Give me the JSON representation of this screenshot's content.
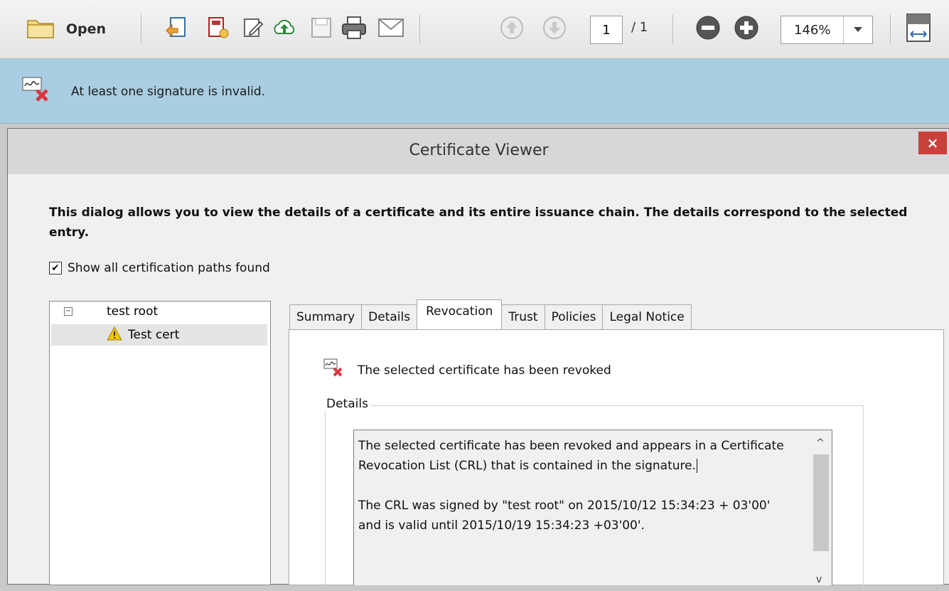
{
  "toolbar": {
    "open_label": "Open",
    "page_current": "1",
    "page_total": "/ 1",
    "zoom_value": "146%",
    "icons": [
      "folder-icon",
      "export-icon",
      "create-pdf-icon",
      "edit-icon",
      "upload-icon",
      "save-icon",
      "print-icon",
      "email-icon",
      "page-up-icon",
      "page-down-icon",
      "zoom-out-icon",
      "zoom-in-icon",
      "fit-width-icon"
    ]
  },
  "infobar": {
    "message": "At least one signature is invalid."
  },
  "dialog": {
    "title": "Certificate Viewer",
    "close_label": "×",
    "intro": "This dialog allows you to view the details of a certificate and its entire issuance chain. The details correspond to the selected entry.",
    "show_all_paths_label": "Show all certification paths found",
    "show_all_paths_checked": true,
    "tree": {
      "expander": "−",
      "root": "test root",
      "child": "Test cert"
    },
    "tabs": [
      {
        "label": "Summary",
        "active": false
      },
      {
        "label": "Details",
        "active": false
      },
      {
        "label": "Revocation",
        "active": true
      },
      {
        "label": "Trust",
        "active": false
      },
      {
        "label": "Policies",
        "active": false
      },
      {
        "label": "Legal Notice",
        "active": false
      }
    ],
    "revocation": {
      "status": "The selected certificate has been revoked",
      "group_label": "Details",
      "details_p1": "The selected certificate has been revoked and appears in a Certificate Revocation List (CRL) that is contained in the signature.",
      "details_p2": "The CRL was signed by \"test root\" on 2015/10/12 15:34:23 + 03'00' and is valid until 2015/10/19 15:34:23 +03'00'."
    }
  },
  "colors": {
    "infobar_bg": "#a9cde1",
    "close_bg": "#c8413a",
    "warning": "#f2c200"
  }
}
